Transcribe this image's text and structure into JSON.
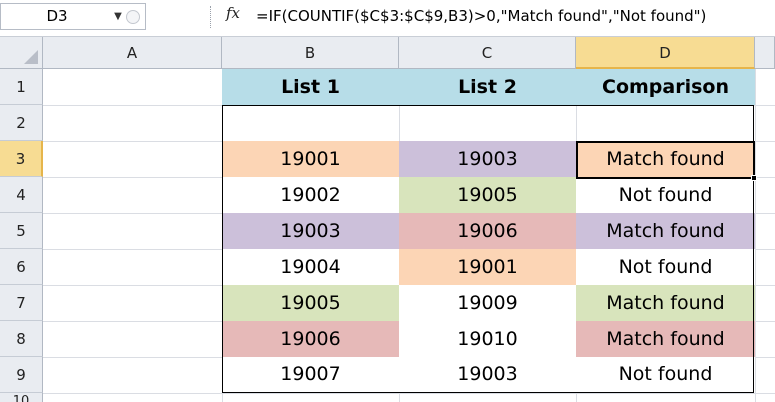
{
  "formula_bar": {
    "name_box": "D3",
    "name_box_arrow": "▼",
    "fx_label": "fx",
    "formula": "=IF(COUNTIF($C$3:$C$9,B3)>0,\"Match found\",\"Not found\")"
  },
  "column_headers": [
    "A",
    "B",
    "C",
    "D"
  ],
  "row_headers": [
    "1",
    "2",
    "3",
    "4",
    "5",
    "6",
    "7",
    "8",
    "9",
    "10"
  ],
  "table": {
    "headers": [
      "List 1",
      "List 2",
      "Comparison"
    ],
    "rows": [
      {
        "list1": "19001",
        "list2": "19003",
        "comparison": "Match found"
      },
      {
        "list1": "19002",
        "list2": "19005",
        "comparison": "Not found"
      },
      {
        "list1": "19003",
        "list2": "19006",
        "comparison": "Match found"
      },
      {
        "list1": "19004",
        "list2": "19001",
        "comparison": "Not found"
      },
      {
        "list1": "19005",
        "list2": "19009",
        "comparison": "Match found"
      },
      {
        "list1": "19006",
        "list2": "19010",
        "comparison": "Match found"
      },
      {
        "list1": "19007",
        "list2": "19003",
        "comparison": "Not found"
      }
    ]
  },
  "selected_cell": "D3",
  "colors": {
    "header_fill": "#b7dde8",
    "orange": "#fcd5b5",
    "purple": "#ccc0da",
    "green": "#d8e4bc",
    "red": "#e6b9b8",
    "active_header": "#f7dc93"
  }
}
